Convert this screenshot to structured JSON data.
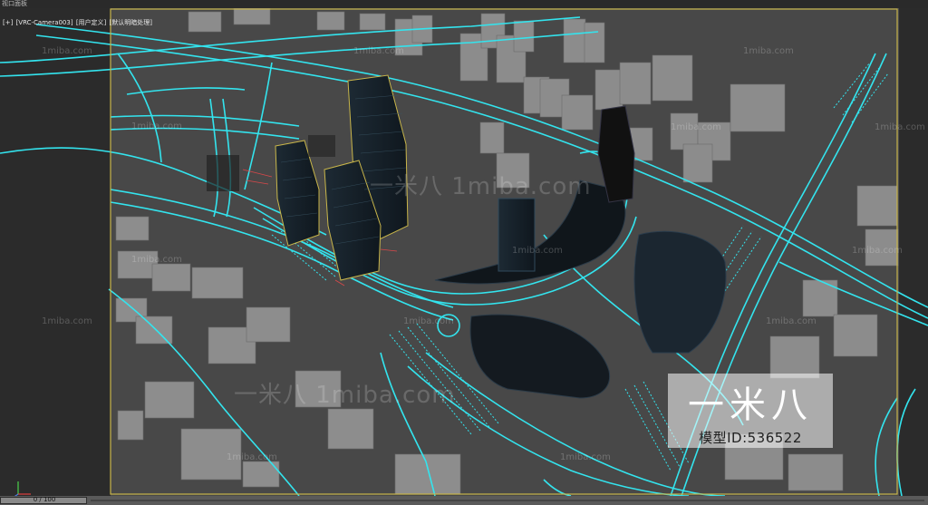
{
  "window": {
    "title": "视口面板"
  },
  "viewport": {
    "label_items": [
      "[+]",
      "[VRC-Camera003]",
      "[用户定义]",
      "[默认明暗处理]"
    ],
    "camera_name": "VRC-Camera003",
    "view_mode": "用户定义",
    "shading": "默认明暗处理",
    "safe_frame_color": "#c8b54a",
    "road_line_color": "#33e4ee",
    "ground_color": "#4b4b4b"
  },
  "watermarks": {
    "small_text": "1miba.com",
    "large_text": "一米八 1miba.com"
  },
  "stamp": {
    "logo": "一米八",
    "model_id": "模型ID:536522"
  },
  "timeline": {
    "frame_counter": "0 / 100"
  },
  "icons": {
    "axis": "axis-gizmo-icon"
  }
}
